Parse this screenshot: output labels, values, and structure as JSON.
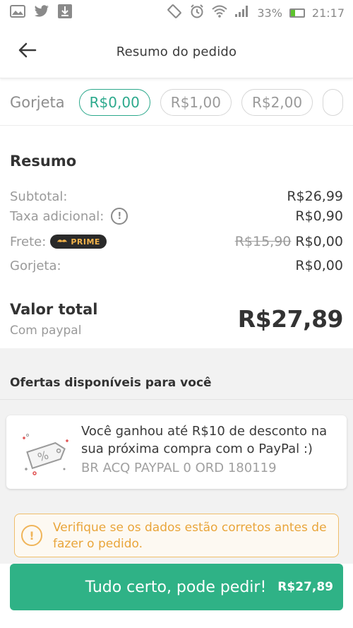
{
  "status_bar": {
    "left_icons": [
      "gallery-icon",
      "twitter-icon",
      "download-icon"
    ],
    "right_icons": [
      "vibrate-icon",
      "alarm-icon",
      "wifi-icon",
      "signal-icon"
    ],
    "battery": "33%",
    "battery_level": 0.33,
    "time": "21:17",
    "colors": {
      "icons": "#8a8a8a",
      "battery_fill": "#5cc22c"
    }
  },
  "header": {
    "back_icon": "arrow-left-icon",
    "title": "Resumo do pedido"
  },
  "tip": {
    "label": "Gorjeta",
    "options": [
      "R$0,00",
      "R$1,00",
      "R$2,00"
    ],
    "selected": "R$0,00"
  },
  "summary": {
    "title": "Resumo",
    "subtotal_label": "Subtotal:",
    "subtotal_value": "R$26,99",
    "fee_label": "Taxa adicional:",
    "fee_icon": "info-icon",
    "fee_value": "R$0,90",
    "shipping_label": "Frete:",
    "shipping_badge": "PRIME",
    "shipping_old_value": "R$15,90",
    "shipping_value": "R$0,00",
    "tip_label": "Gorjeta:",
    "tip_value": "R$0,00",
    "total_label": "Valor total",
    "payment_method": "Com paypal",
    "total_value": "R$27,89"
  },
  "offers": {
    "title": "Ofertas disponíveis para você",
    "card_icon": "discount-tag-icon",
    "card_text": "Você ganhou até R$10 de desconto na sua próxima compra com o PayPal :)",
    "card_code": "BR ACQ PAYPAL 0 ORD 180119"
  },
  "warning": {
    "icon": "alert-icon",
    "text": "Verifique se os dados estão corretos antes de fazer o pedido."
  },
  "cta": {
    "label": "Tudo certo, pode pedir!",
    "price": "R$27,89",
    "color": "#2fb286"
  }
}
